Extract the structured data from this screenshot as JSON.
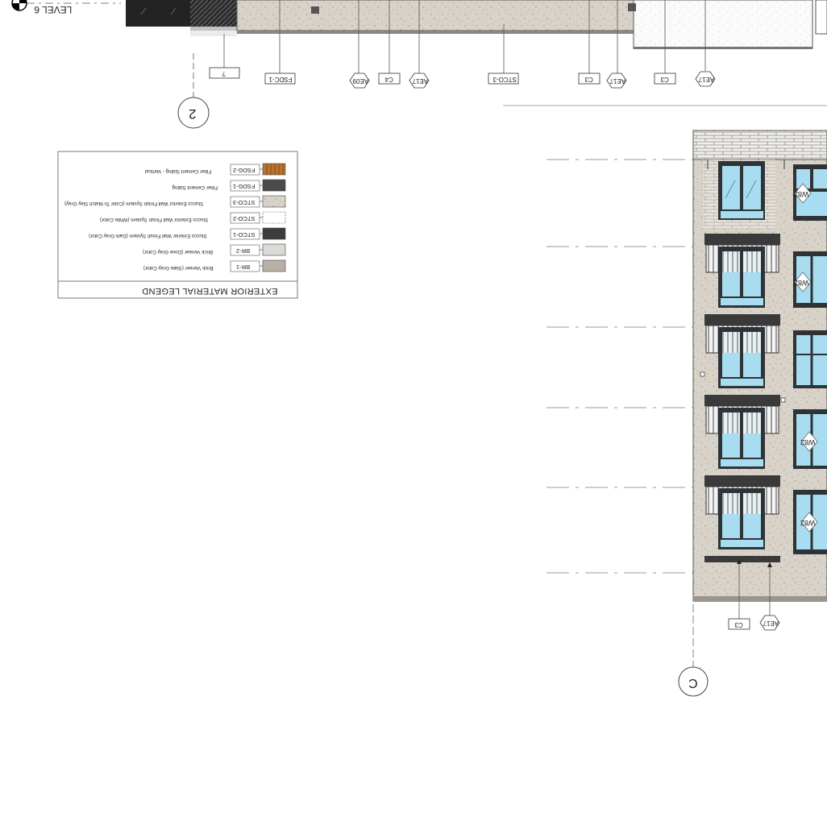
{
  "drawing": {
    "level_label": "LEVEL 6",
    "grid_bubble_left": "2",
    "grid_bubble_right": "C"
  },
  "callouts_top": [
    {
      "id": "c-q",
      "text": "?",
      "shape": "rect"
    },
    {
      "id": "c-fsdc",
      "text": "FSDC-1",
      "shape": "rect"
    },
    {
      "id": "c-ae09",
      "text": "AE09",
      "shape": "hex"
    },
    {
      "id": "c-c4",
      "text": "C4",
      "shape": "rect"
    },
    {
      "id": "c-ae17a",
      "text": "AE17",
      "shape": "hex"
    },
    {
      "id": "c-stco3",
      "text": "STCO-3",
      "shape": "rect"
    },
    {
      "id": "c-c3a",
      "text": "C3",
      "shape": "rect"
    },
    {
      "id": "c-ae17b",
      "text": "AE17",
      "shape": "hex"
    },
    {
      "id": "c-c3b",
      "text": "C3",
      "shape": "rect"
    },
    {
      "id": "c-ae17c",
      "text": "AE17",
      "shape": "hex"
    }
  ],
  "callouts_bottom": [
    {
      "id": "b-c3",
      "text": "C3",
      "shape": "rect"
    },
    {
      "id": "b-ae17",
      "text": "AE17",
      "shape": "hex"
    }
  ],
  "window_tags": [
    "W82",
    "W82",
    "W82",
    "W82"
  ],
  "legend": {
    "title": "EXTERIOR MATERIAL LEGEND",
    "items": [
      {
        "code": "BR-1",
        "desc": "Brick Veneer (Slate Gray Color)",
        "color": "#b8b0a4"
      },
      {
        "code": "BR-2",
        "desc": "Brick Veneer (Dove Gray Color)",
        "color": "#dcdad6"
      },
      {
        "code": "STCO-1",
        "desc": "Stucco Exterior Wall Finish System (Dark Gray Color)",
        "color": "#3c3c3c"
      },
      {
        "code": "STCO-2",
        "desc": "Stucco Exterior Wall Finish System (White Color)",
        "color": "#ffffff"
      },
      {
        "code": "STCO-3",
        "desc": "Stucco Exterior Wall Finish System (Color To Match Slay Gray)",
        "color": "#b9b2a6"
      },
      {
        "code": "FSDG-1",
        "desc": "Fiber Cement Siding",
        "color": "#4a4a4a"
      },
      {
        "code": "FSDG-2",
        "desc": "Fiber Cement Siding - Vertical",
        "color": "#b8742e"
      }
    ]
  },
  "colors": {
    "stucco": "#d6d0c6",
    "brick": "#cfc8bc",
    "glass": "#a8dcf0",
    "frame": "#2e3436",
    "dark": "#333333"
  }
}
